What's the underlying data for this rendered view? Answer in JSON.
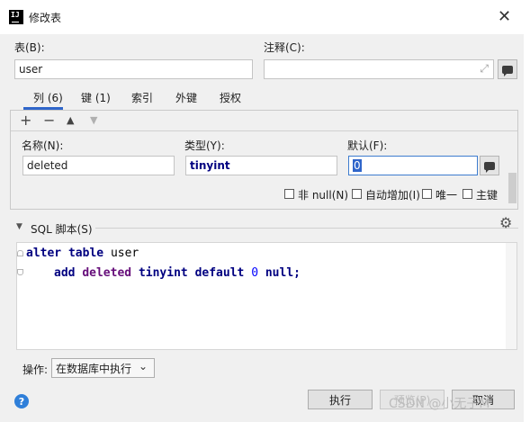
{
  "dialog": {
    "title": "修改表",
    "close_glyph": "✕"
  },
  "table_field": {
    "label": "表(B):",
    "value": "user"
  },
  "comment_field": {
    "label": "注释(C):",
    "value": "",
    "expand_glyph": "⤢"
  },
  "tabs": [
    {
      "label": "列 (6)",
      "active": true
    },
    {
      "label": "键 (1)",
      "active": false
    },
    {
      "label": "索引",
      "active": false
    },
    {
      "label": "外键",
      "active": false
    },
    {
      "label": "授权",
      "active": false
    }
  ],
  "column_toolbar": {
    "add": "+",
    "remove": "−",
    "up": "▲",
    "down": "▼"
  },
  "column_editor": {
    "name_label": "名称(N):",
    "name_value": "deleted",
    "type_label": "类型(Y):",
    "type_value": "tinyint",
    "default_label": "默认(F):",
    "default_value": "0",
    "checkboxes": [
      {
        "label": "非 null(N)",
        "checked": false
      },
      {
        "label": "自动增加(I)",
        "checked": false
      },
      {
        "label": "唯一",
        "checked": false
      },
      {
        "label": "主键",
        "checked": false
      }
    ]
  },
  "sql_section": {
    "toggle_glyph": "▼",
    "label": "SQL 脚本(S)",
    "gear_glyph": "⚙",
    "lines": [
      {
        "kw1": "alter",
        "kw2": "table",
        "ident": "user"
      },
      {
        "kw1": "add",
        "col": "deleted",
        "type": "tinyint",
        "kw2": "default",
        "num": "0",
        "kw3": "null;"
      }
    ]
  },
  "operation": {
    "label": "操作:",
    "selected": "在数据库中执行",
    "chevron": "⌄"
  },
  "footer": {
    "help_glyph": "?",
    "execute_label": "执行",
    "preview_label": "预览(P)",
    "cancel_label": "取消",
    "watermark": "CSDN @小无子M"
  },
  "colors": {
    "accent": "#2f65ca",
    "keyword": "#000080",
    "column": "#660e7a",
    "number": "#0000ff"
  }
}
